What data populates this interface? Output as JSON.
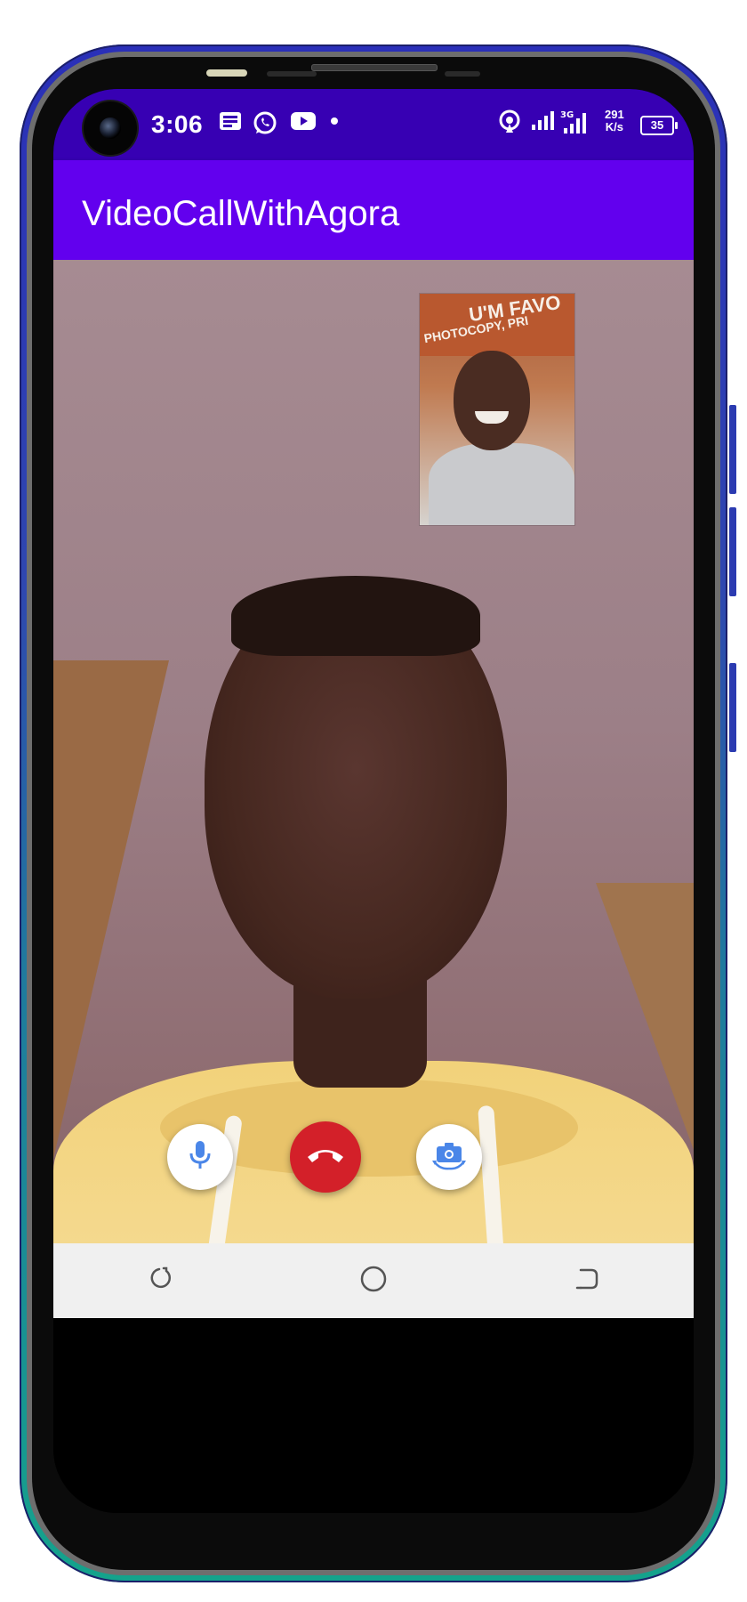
{
  "status_bar": {
    "time": "3:06",
    "net_speed_value": "291",
    "net_speed_unit": "K/s",
    "battery": "35",
    "notification_icons": [
      "news-icon",
      "whatsapp-icon",
      "youtube-icon",
      "dot-icon"
    ],
    "system_icons": [
      "hotspot-icon",
      "signal-icon",
      "signal-hd-icon",
      "battery-icon"
    ]
  },
  "app_bar": {
    "title": "VideoCallWithAgora"
  },
  "local_video": {
    "sign_line1": "U'M FAVO",
    "sign_line2": "PHOTOCOPY, PRI"
  },
  "controls": [
    {
      "name": "mute-microphone",
      "icon": "microphone-icon"
    },
    {
      "name": "end-call",
      "icon": "phone-hangup-icon"
    },
    {
      "name": "switch-camera",
      "icon": "camera-switch-icon"
    }
  ],
  "navigation": {
    "items": [
      "recents-icon",
      "home-icon",
      "back-icon"
    ]
  },
  "colors": {
    "status_bar": "#3700b3",
    "app_bar": "#6200ee",
    "end_call": "#d32029",
    "accent_blue": "#4a86e8"
  }
}
